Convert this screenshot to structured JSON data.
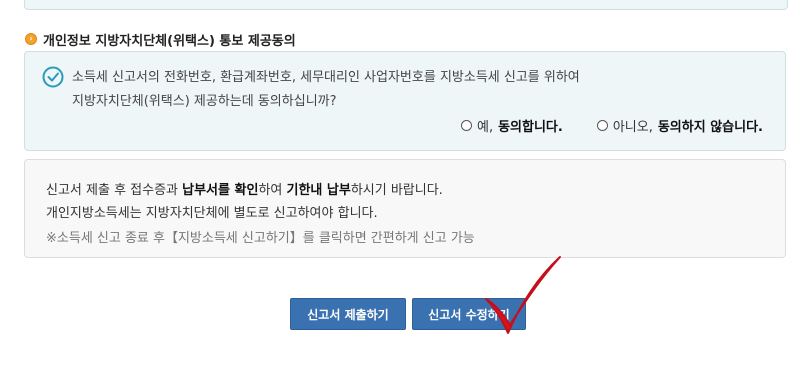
{
  "section": {
    "title": "개인정보 지방자치단체(위택스) 통보 제공동의"
  },
  "consent": {
    "line1": "소득세 신고서의 전화번호, 환급계좌번호, 세무대리인 사업자번호를 지방소득세 신고를 위하여",
    "line2": "지방자치단체(위택스) 제공하는데 동의하십니까?",
    "yes_prefix": "예, ",
    "yes_bold": "동의합니다.",
    "no_prefix": "아니오, ",
    "no_bold": "동의하지 않습니다."
  },
  "notice": {
    "line1_a": "신고서 제출 후 접수증과 ",
    "line1_b": "납부서를 확인",
    "line1_c": "하여 ",
    "line1_d": "기한내 납부",
    "line1_e": "하시기 바랍니다.",
    "line2": "개인지방소득세는 지방자치단체에 별도로 신고하여야 합니다.",
    "line3": "※소득세 신고 종료 후【지방소득세 신고하기】를 클릭하면 간편하게 신고 가능"
  },
  "buttons": {
    "submit": "신고서 제출하기",
    "modify": "신고서 수정하기"
  },
  "colors": {
    "accent_blue": "#3a71b0",
    "consent_bg": "#eef6f8",
    "check_teal": "#2a9bb8",
    "annotation_red": "#d8141c",
    "bullet_orange": "#f2a22a"
  },
  "icons": [
    "orange-bullet-icon",
    "check-circle-icon",
    "radio-icon",
    "red-checkmark-annotation"
  ]
}
